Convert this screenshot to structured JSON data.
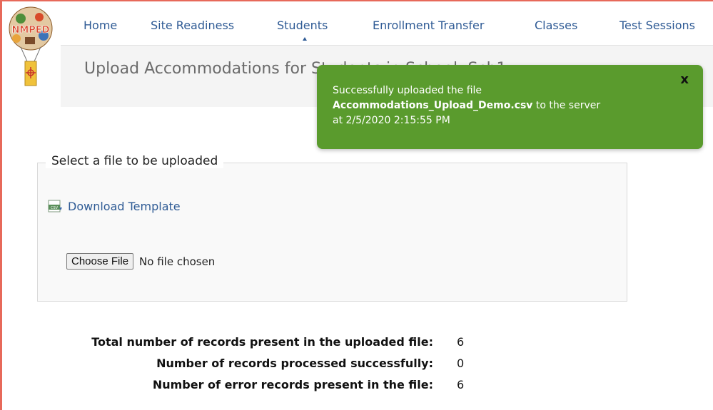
{
  "logo": {
    "text": "NMPED"
  },
  "nav": {
    "items": [
      {
        "label": "Home"
      },
      {
        "label": "Site Readiness"
      },
      {
        "label": "Students"
      },
      {
        "label": "Enrollment Transfer"
      },
      {
        "label": "Classes"
      },
      {
        "label": "Test Sessions"
      }
    ],
    "active": "Students"
  },
  "page": {
    "title": "Upload Accommodations for Students in School: Sch1"
  },
  "toast": {
    "line1": "Successfully uploaded the file",
    "filename": "Accommodations_Upload_Demo.csv",
    "line2_suffix": " to the server",
    "line3": "at 2/5/2020 2:15:55 PM",
    "close": "x"
  },
  "upload": {
    "legend": "Select a file to be uploaded",
    "download_label": "Download Template",
    "choose_label": "Choose File",
    "no_file": "No file chosen"
  },
  "stats": [
    {
      "label": "Total number of records present in the uploaded file:",
      "value": "6"
    },
    {
      "label": "Number of records processed successfully:",
      "value": "0"
    },
    {
      "label": "Number of error records present in the file:",
      "value": "6"
    }
  ],
  "colors": {
    "accent": "#2f5b95",
    "toast": "#5a9b2d",
    "frame": "#e7695a"
  }
}
